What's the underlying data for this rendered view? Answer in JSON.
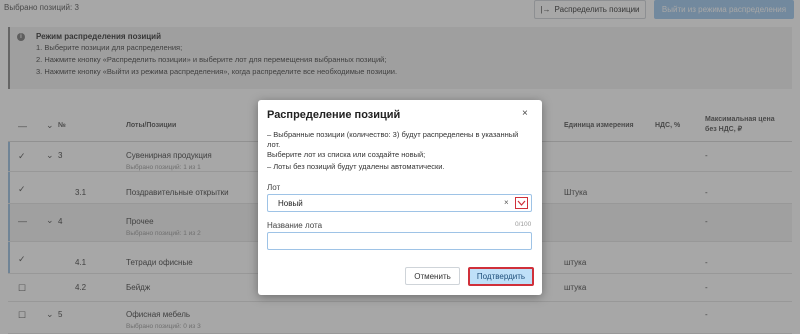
{
  "topbar": {
    "selected_count": "Выбрано позиций: 3",
    "distribute_button": "Распределить позиции",
    "exit_button": "Выйти из режима распределения"
  },
  "info": {
    "title": "Режим распределения позиций",
    "steps": [
      "1.  Выберите позиции для распределения;",
      "2.  Нажмите кнопку «Распределить позиции» и выберите лот для перемещения выбранных позиций;",
      "3.  Нажмите кнопку «Выйти из режима распределения», когда распределите все необходимые позиции."
    ]
  },
  "table": {
    "headers": {
      "number": "№",
      "lots": "Лоты/Позиции",
      "unit": "Единица измерения",
      "vat": "НДС, %",
      "max_price_line1": "Максимальная цена",
      "max_price_line2": "без НДС, ₽"
    },
    "rows": [
      {
        "num": "3",
        "name": "Сувенирная продукция",
        "sub": "Выбрано позиций: 1 из 1",
        "unit": "",
        "vat": "-",
        "price": ""
      },
      {
        "num": "3.1",
        "name": "Поздравительные открытки",
        "sub": "",
        "unit": "Штука",
        "vat": "-",
        "price": ""
      },
      {
        "num": "4",
        "name": "Прочее",
        "sub": "Выбрано позиций: 1 из 2",
        "unit": "",
        "vat": "-",
        "price": ""
      },
      {
        "num": "4.1",
        "name": "Тетради офисные",
        "sub": "",
        "unit": "штука",
        "vat": "-",
        "price": ""
      },
      {
        "num": "4.2",
        "name": "Бейдж",
        "sub": "",
        "unit": "штука",
        "vat": "-",
        "price": ""
      },
      {
        "num": "5",
        "name": "Офисная мебель",
        "sub": "Выбрано позиций: 0 из 3",
        "unit": "",
        "vat": "-",
        "price": ""
      }
    ]
  },
  "modal": {
    "title": "Распределение позиций",
    "close": "×",
    "notes": [
      "–  Выбранные позиции (количество: 3) будут распределены в указанный",
      "    лот.",
      "    Выберите лот из списка или создайте новый;",
      "–  Лоты без позиций будут удалены автоматически."
    ],
    "lot_label": "Лот",
    "lot_value": "Новый",
    "lot_clear": "×",
    "name_label": "Название лота",
    "name_counter": "0/100",
    "name_value": "",
    "cancel_button": "Отменить",
    "confirm_button": "Подтвердить"
  },
  "colors": {
    "accent": "#9fc9ef",
    "highlight": "#d0303a"
  }
}
